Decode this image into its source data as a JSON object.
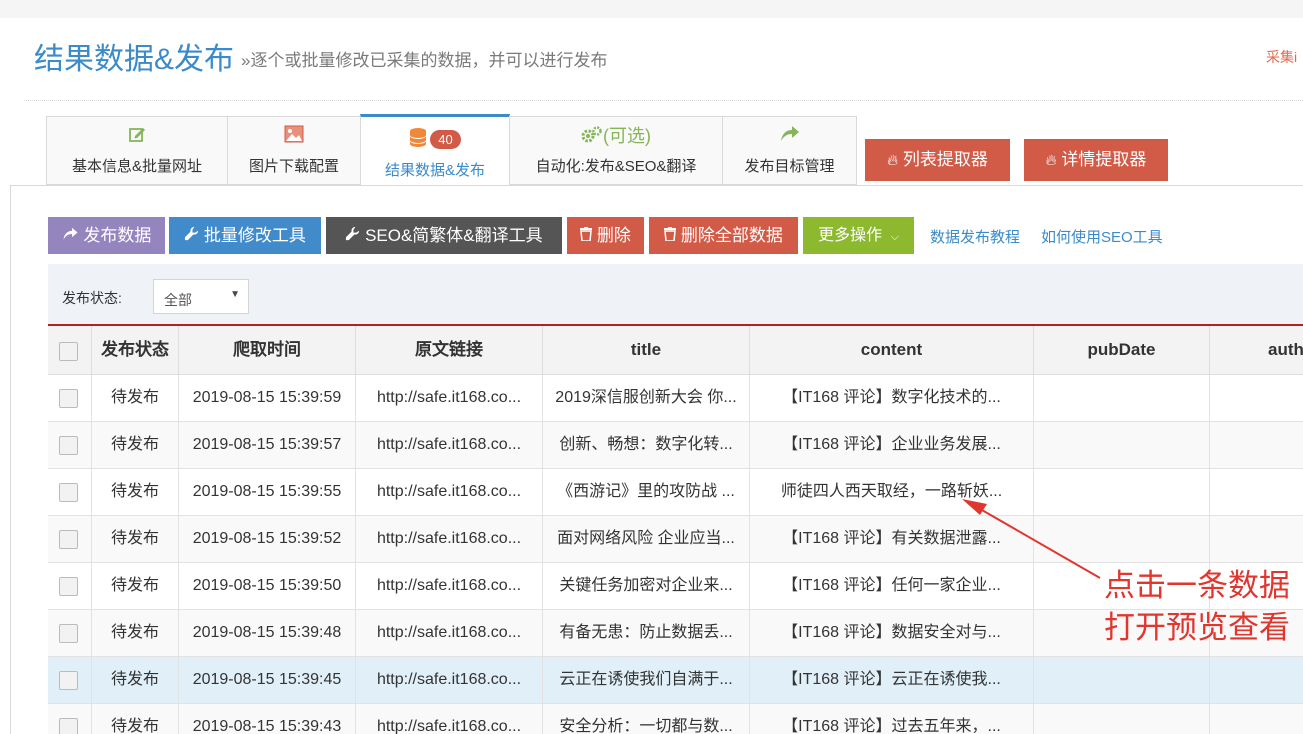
{
  "header": {
    "title": "结果数据&发布",
    "subtitle": "»逐个或批量修改已采集的数据，并可以进行发布",
    "corner_link": "采集i"
  },
  "tabs": [
    {
      "label": "基本信息&批量网址",
      "icon": "edit-icon"
    },
    {
      "label": "图片下载配置",
      "icon": "picture-icon"
    },
    {
      "label": "结果数据&发布",
      "icon": "database-icon",
      "badge": "40",
      "active": true
    },
    {
      "label": "自动化:发布&SEO&翻译",
      "icon": "gears-icon",
      "extra": "(可选)"
    },
    {
      "label": "发布目标管理",
      "icon": "share-icon"
    }
  ],
  "extractors": {
    "list": "列表提取器",
    "detail": "详情提取器"
  },
  "toolbar": {
    "publish": "发布数据",
    "batch_edit": "批量修改工具",
    "seo": "SEO&简繁体&翻译工具",
    "delete": "删除",
    "delete_all": "删除全部数据",
    "more": "更多操作",
    "link_tutorial": "数据发布教程",
    "link_seo": "如何使用SEO工具"
  },
  "filter": {
    "label": "发布状态:",
    "selected": "全部"
  },
  "table": {
    "columns": [
      "发布状态",
      "爬取时间",
      "原文链接",
      "title",
      "content",
      "pubDate",
      "auth"
    ],
    "rows": [
      {
        "status": "待发布",
        "time": "2019-08-15 15:39:59",
        "link": "http://safe.it168.co...",
        "title": "2019深信服创新大会 你...",
        "content": "【IT168 评论】数字化技术的..."
      },
      {
        "status": "待发布",
        "time": "2019-08-15 15:39:57",
        "link": "http://safe.it168.co...",
        "title": "创新、畅想：数字化转...",
        "content": "【IT168 评论】企业业务发展..."
      },
      {
        "status": "待发布",
        "time": "2019-08-15 15:39:55",
        "link": "http://safe.it168.co...",
        "title": "《西游记》里的攻防战 ...",
        "content": "师徒四人西天取经，一路斩妖..."
      },
      {
        "status": "待发布",
        "time": "2019-08-15 15:39:52",
        "link": "http://safe.it168.co...",
        "title": "面对网络风险 企业应当...",
        "content": "【IT168 评论】有关数据泄露..."
      },
      {
        "status": "待发布",
        "time": "2019-08-15 15:39:50",
        "link": "http://safe.it168.co...",
        "title": "关键任务加密对企业来...",
        "content": "【IT168 评论】任何一家企业..."
      },
      {
        "status": "待发布",
        "time": "2019-08-15 15:39:48",
        "link": "http://safe.it168.co...",
        "title": "有备无患：防止数据丢...",
        "content": "【IT168 评论】数据安全对与..."
      },
      {
        "status": "待发布",
        "time": "2019-08-15 15:39:45",
        "link": "http://safe.it168.co...",
        "title": "云正在诱使我们自满于...",
        "content": "【IT168 评论】云正在诱使我...",
        "selected": true
      },
      {
        "status": "待发布",
        "time": "2019-08-15 15:39:43",
        "link": "http://safe.it168.co...",
        "title": "安全分析：一切都与数...",
        "content": "【IT168 评论】过去五年来，..."
      }
    ]
  },
  "annotation": {
    "line1": "点击一条数据",
    "line2": "打开预览查看"
  },
  "colors": {
    "accent": "#3b8ac9",
    "danger": "#d15b47",
    "annotation": "#e0362e",
    "selected_row": "#e0eff8"
  }
}
